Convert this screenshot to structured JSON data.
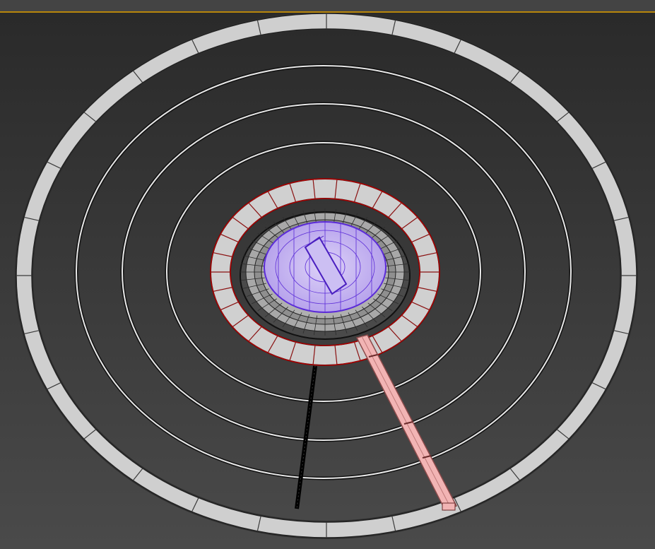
{
  "viewport": {
    "accent_color": "#b8860b",
    "background_top": "#2a2a2a",
    "background_bottom": "#4a4a4a"
  },
  "scene": {
    "objects": [
      {
        "name": "outer-ring",
        "kind": "thick-ring",
        "color": "#cfcfcf"
      },
      {
        "name": "wire-ring-1",
        "kind": "thin-ring",
        "color": "#e0e0e0"
      },
      {
        "name": "wire-ring-2",
        "kind": "thin-ring",
        "color": "#e0e0e0"
      },
      {
        "name": "wire-ring-3",
        "kind": "thin-ring",
        "color": "#e0e0e0"
      },
      {
        "name": "selected-tiled-ring",
        "kind": "thick-ring",
        "color": "#d0d0d0",
        "selection_color": "#b00000"
      },
      {
        "name": "inner-gray-mesh",
        "kind": "mesh-disc",
        "color": "#9a9a9a"
      },
      {
        "name": "purple-dome",
        "kind": "mesh-disc",
        "color": "#c9b8f0",
        "wire_color": "#5b2bd8"
      },
      {
        "name": "black-rod",
        "kind": "rod",
        "color": "#111111"
      },
      {
        "name": "pink-beam",
        "kind": "beam",
        "color": "#f2b4b4"
      }
    ]
  }
}
